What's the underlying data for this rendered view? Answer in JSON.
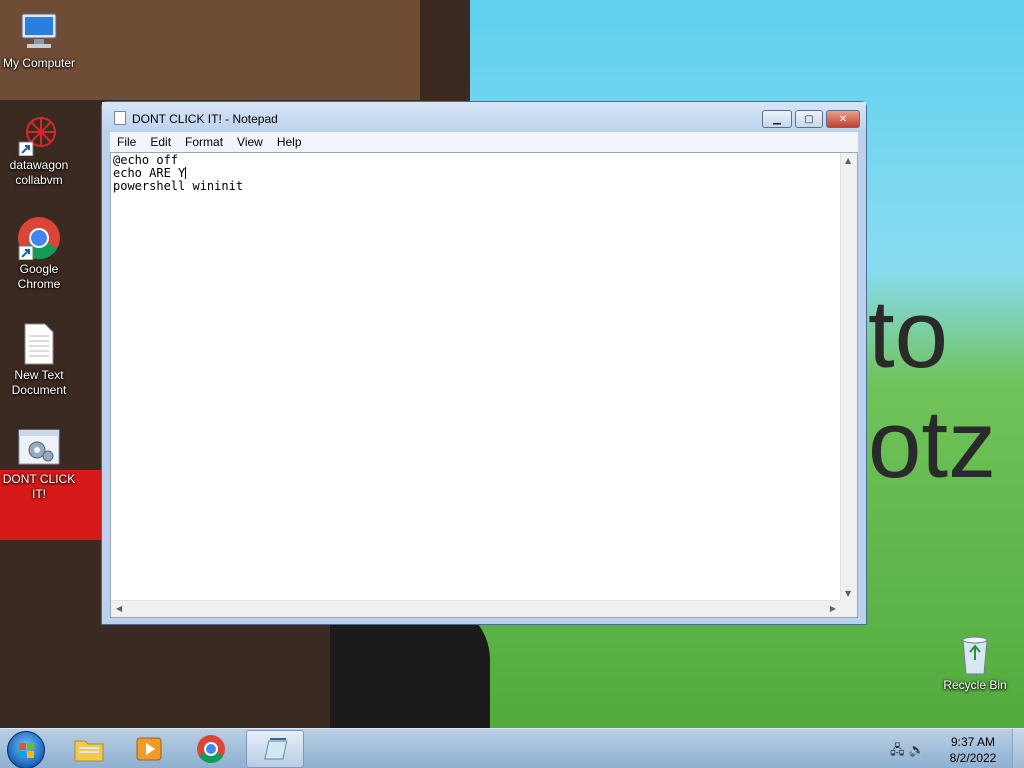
{
  "desktop": {
    "background_text": [
      "to",
      "otz"
    ],
    "icons": [
      {
        "label": "My Computer",
        "icon": "computer-icon"
      },
      {
        "label": "datawagon collabvm",
        "icon": "datawagon-shortcut-icon"
      },
      {
        "label": "Google Chrome",
        "icon": "chrome-icon"
      },
      {
        "label": "New Text Document",
        "icon": "text-document-icon"
      },
      {
        "label": "DONT CLICK IT!",
        "icon": "batch-file-icon"
      },
      {
        "label": "Recycle Bin",
        "icon": "recycle-bin-icon"
      }
    ]
  },
  "notepad": {
    "title": "DONT CLICK IT! - Notepad",
    "minimize": "▁",
    "maximize": "▢",
    "close": "✕",
    "menu": [
      "File",
      "Edit",
      "Format",
      "View",
      "Help"
    ],
    "lines": [
      "@echo off",
      "echo ARE Y",
      "powershell wininit"
    ]
  },
  "taskbar": {
    "items": [
      "start-orb",
      "explorer",
      "media-player",
      "chrome",
      "notepad"
    ],
    "time": "9:37 AM",
    "date": "8/2/2022"
  }
}
